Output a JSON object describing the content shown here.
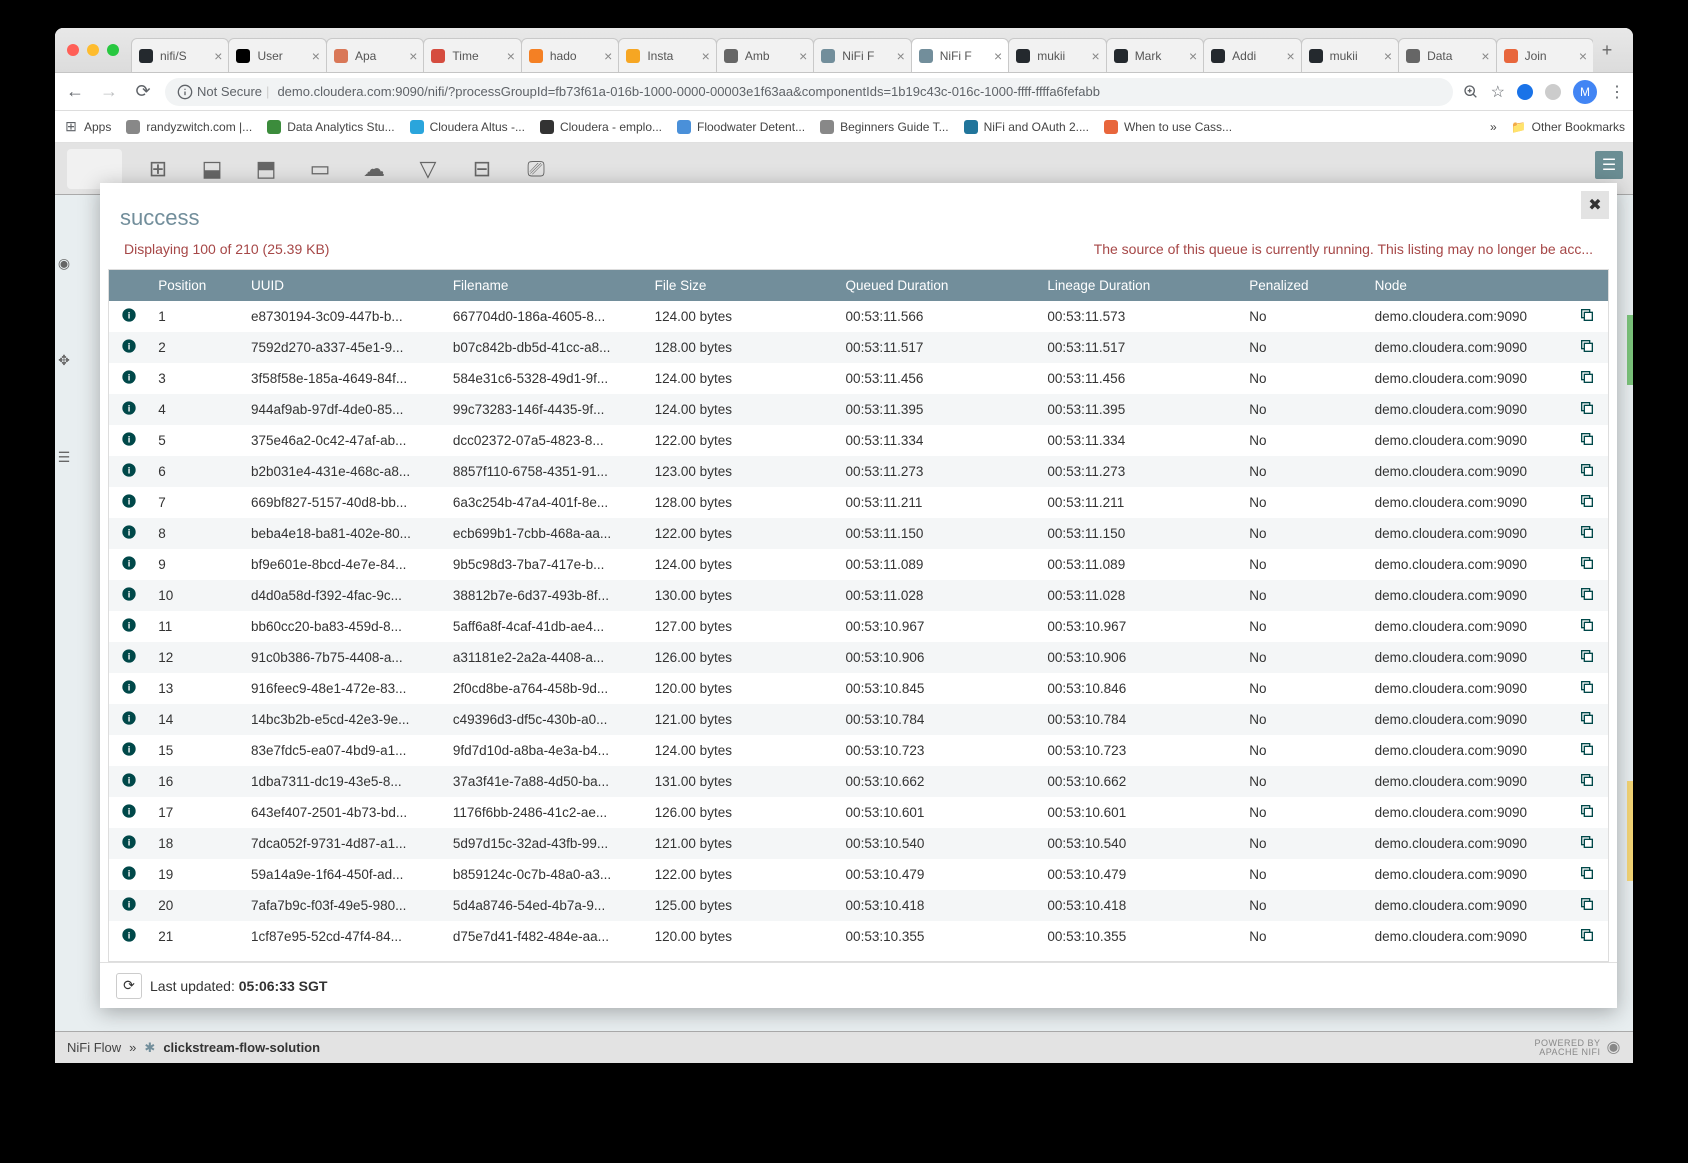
{
  "browser": {
    "tabs": [
      {
        "label": "nifi/S",
        "icon": "github"
      },
      {
        "label": "User",
        "icon": "n"
      },
      {
        "label": "Apa",
        "icon": "feather"
      },
      {
        "label": "Time",
        "icon": "cal"
      },
      {
        "label": "hado",
        "icon": "so"
      },
      {
        "label": "Insta",
        "icon": "box"
      },
      {
        "label": "Amb",
        "icon": "dots"
      },
      {
        "label": "NiFi F",
        "icon": "nifi"
      },
      {
        "label": "NiFi F",
        "icon": "nifi",
        "active": true
      },
      {
        "label": "mukii",
        "icon": "github"
      },
      {
        "label": "Mark",
        "icon": "github"
      },
      {
        "label": "Addi",
        "icon": "github"
      },
      {
        "label": "mukii",
        "icon": "github"
      },
      {
        "label": "Data",
        "icon": "hex"
      },
      {
        "label": "Join",
        "icon": "circle"
      }
    ],
    "address": {
      "secure_label": "Not Secure",
      "url": "demo.cloudera.com:9090/nifi/?processGroupId=fb73f61a-016b-1000-0000-00003e1f63aa&componentIds=1b19c43c-016c-1000-ffff-ffffa6fefabb"
    },
    "bookmarks": [
      {
        "label": "Apps",
        "icon": "grid"
      },
      {
        "label": "randyzwitch.com |...",
        "icon": "globe"
      },
      {
        "label": "Data Analytics Stu...",
        "icon": "green"
      },
      {
        "label": "Cloudera Altus -...",
        "icon": "c"
      },
      {
        "label": "Cloudera - emplo...",
        "icon": "cl"
      },
      {
        "label": "Floodwater Detent...",
        "icon": "drop"
      },
      {
        "label": "Beginners Guide T...",
        "icon": "globe"
      },
      {
        "label": "NiFi and OAuth 2....",
        "icon": "wp"
      },
      {
        "label": "When to use Cass...",
        "icon": "circle"
      }
    ],
    "other_bookmarks": "Other Bookmarks"
  },
  "modal": {
    "title": "success",
    "display_text": "Displaying 100 of 210 (25.39 KB)",
    "warning": "The source of this queue is currently running. This listing may no longer be acc...",
    "columns": [
      "",
      "Position",
      "UUID",
      "Filename",
      "File Size",
      "Queued Duration",
      "Lineage Duration",
      "Penalized",
      "Node",
      ""
    ],
    "rows": [
      {
        "pos": "1",
        "uuid": "e8730194-3c09-447b-b...",
        "file": "667704d0-186a-4605-8...",
        "size": "124.00 bytes",
        "q": "00:53:11.566",
        "l": "00:53:11.573",
        "pen": "No",
        "node": "demo.cloudera.com:9090"
      },
      {
        "pos": "2",
        "uuid": "7592d270-a337-45e1-9...",
        "file": "b07c842b-db5d-41cc-a8...",
        "size": "128.00 bytes",
        "q": "00:53:11.517",
        "l": "00:53:11.517",
        "pen": "No",
        "node": "demo.cloudera.com:9090"
      },
      {
        "pos": "3",
        "uuid": "3f58f58e-185a-4649-84f...",
        "file": "584e31c6-5328-49d1-9f...",
        "size": "124.00 bytes",
        "q": "00:53:11.456",
        "l": "00:53:11.456",
        "pen": "No",
        "node": "demo.cloudera.com:9090"
      },
      {
        "pos": "4",
        "uuid": "944af9ab-97df-4de0-85...",
        "file": "99c73283-146f-4435-9f...",
        "size": "124.00 bytes",
        "q": "00:53:11.395",
        "l": "00:53:11.395",
        "pen": "No",
        "node": "demo.cloudera.com:9090"
      },
      {
        "pos": "5",
        "uuid": "375e46a2-0c42-47af-ab...",
        "file": "dcc02372-07a5-4823-8...",
        "size": "122.00 bytes",
        "q": "00:53:11.334",
        "l": "00:53:11.334",
        "pen": "No",
        "node": "demo.cloudera.com:9090"
      },
      {
        "pos": "6",
        "uuid": "b2b031e4-431e-468c-a8...",
        "file": "8857f110-6758-4351-91...",
        "size": "123.00 bytes",
        "q": "00:53:11.273",
        "l": "00:53:11.273",
        "pen": "No",
        "node": "demo.cloudera.com:9090"
      },
      {
        "pos": "7",
        "uuid": "669bf827-5157-40d8-bb...",
        "file": "6a3c254b-47a4-401f-8e...",
        "size": "128.00 bytes",
        "q": "00:53:11.211",
        "l": "00:53:11.211",
        "pen": "No",
        "node": "demo.cloudera.com:9090"
      },
      {
        "pos": "8",
        "uuid": "beba4e18-ba81-402e-80...",
        "file": "ecb699b1-7cbb-468a-aa...",
        "size": "122.00 bytes",
        "q": "00:53:11.150",
        "l": "00:53:11.150",
        "pen": "No",
        "node": "demo.cloudera.com:9090"
      },
      {
        "pos": "9",
        "uuid": "bf9e601e-8bcd-4e7e-84...",
        "file": "9b5c98d3-7ba7-417e-b...",
        "size": "124.00 bytes",
        "q": "00:53:11.089",
        "l": "00:53:11.089",
        "pen": "No",
        "node": "demo.cloudera.com:9090"
      },
      {
        "pos": "10",
        "uuid": "d4d0a58d-f392-4fac-9c...",
        "file": "38812b7e-6d37-493b-8f...",
        "size": "130.00 bytes",
        "q": "00:53:11.028",
        "l": "00:53:11.028",
        "pen": "No",
        "node": "demo.cloudera.com:9090"
      },
      {
        "pos": "11",
        "uuid": "bb60cc20-ba83-459d-8...",
        "file": "5aff6a8f-4caf-41db-ae4...",
        "size": "127.00 bytes",
        "q": "00:53:10.967",
        "l": "00:53:10.967",
        "pen": "No",
        "node": "demo.cloudera.com:9090"
      },
      {
        "pos": "12",
        "uuid": "91c0b386-7b75-4408-a...",
        "file": "a31181e2-2a2a-4408-a...",
        "size": "126.00 bytes",
        "q": "00:53:10.906",
        "l": "00:53:10.906",
        "pen": "No",
        "node": "demo.cloudera.com:9090"
      },
      {
        "pos": "13",
        "uuid": "916feec9-48e1-472e-83...",
        "file": "2f0cd8be-a764-458b-9d...",
        "size": "120.00 bytes",
        "q": "00:53:10.845",
        "l": "00:53:10.846",
        "pen": "No",
        "node": "demo.cloudera.com:9090"
      },
      {
        "pos": "14",
        "uuid": "14bc3b2b-e5cd-42e3-9e...",
        "file": "c49396d3-df5c-430b-a0...",
        "size": "121.00 bytes",
        "q": "00:53:10.784",
        "l": "00:53:10.784",
        "pen": "No",
        "node": "demo.cloudera.com:9090"
      },
      {
        "pos": "15",
        "uuid": "83e7fdc5-ea07-4bd9-a1...",
        "file": "9fd7d10d-a8ba-4e3a-b4...",
        "size": "124.00 bytes",
        "q": "00:53:10.723",
        "l": "00:53:10.723",
        "pen": "No",
        "node": "demo.cloudera.com:9090"
      },
      {
        "pos": "16",
        "uuid": "1dba7311-dc19-43e5-8...",
        "file": "37a3f41e-7a88-4d50-ba...",
        "size": "131.00 bytes",
        "q": "00:53:10.662",
        "l": "00:53:10.662",
        "pen": "No",
        "node": "demo.cloudera.com:9090"
      },
      {
        "pos": "17",
        "uuid": "643ef407-2501-4b73-bd...",
        "file": "1176f6bb-2486-41c2-ae...",
        "size": "126.00 bytes",
        "q": "00:53:10.601",
        "l": "00:53:10.601",
        "pen": "No",
        "node": "demo.cloudera.com:9090"
      },
      {
        "pos": "18",
        "uuid": "7dca052f-9731-4d87-a1...",
        "file": "5d97d15c-32ad-43fb-99...",
        "size": "121.00 bytes",
        "q": "00:53:10.540",
        "l": "00:53:10.540",
        "pen": "No",
        "node": "demo.cloudera.com:9090"
      },
      {
        "pos": "19",
        "uuid": "59a14a9e-1f64-450f-ad...",
        "file": "b859124c-0c7b-48a0-a3...",
        "size": "122.00 bytes",
        "q": "00:53:10.479",
        "l": "00:53:10.479",
        "pen": "No",
        "node": "demo.cloudera.com:9090"
      },
      {
        "pos": "20",
        "uuid": "7afa7b9c-f03f-49e5-980...",
        "file": "5d4a8746-54ed-4b7a-9...",
        "size": "125.00 bytes",
        "q": "00:53:10.418",
        "l": "00:53:10.418",
        "pen": "No",
        "node": "demo.cloudera.com:9090"
      },
      {
        "pos": "21",
        "uuid": "1cf87e95-52cd-47f4-84...",
        "file": "d75e7d41-f482-484e-aa...",
        "size": "120.00 bytes",
        "q": "00:53:10.355",
        "l": "00:53:10.355",
        "pen": "No",
        "node": "demo.cloudera.com:9090"
      }
    ],
    "last_updated_label": "Last updated: ",
    "last_updated_time": "05:06:33 SGT"
  },
  "footer": {
    "root": "NiFi Flow",
    "sep": "»",
    "child": "clickstream-flow-solution",
    "powered1": "POWERED BY",
    "powered2": "APACHE NIFI"
  }
}
